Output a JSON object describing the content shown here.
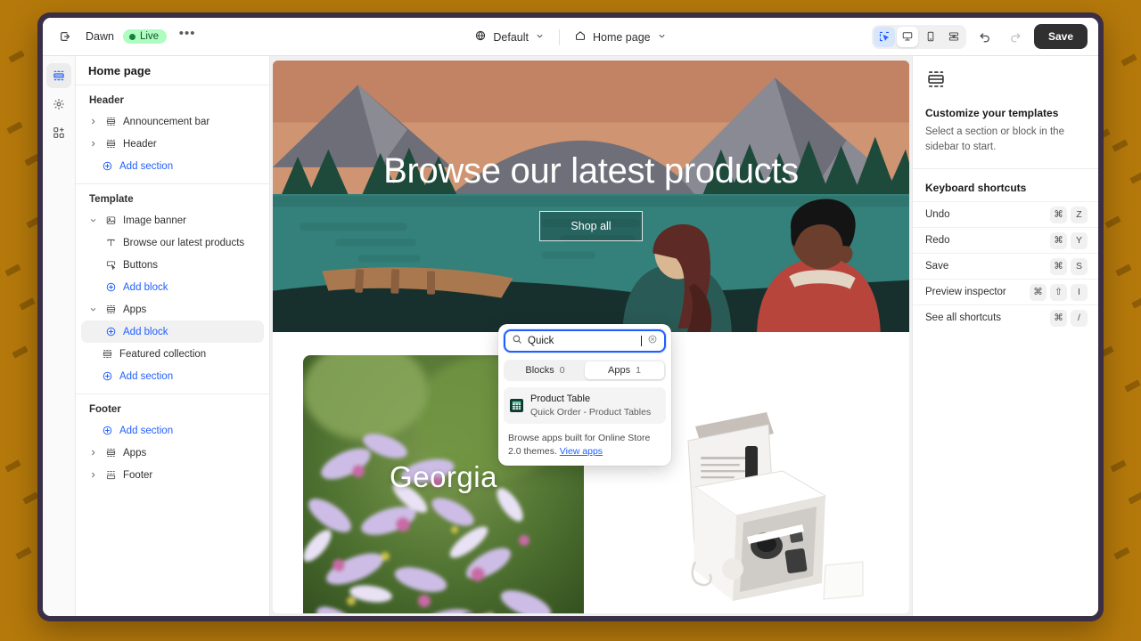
{
  "topbar": {
    "back_icon": "exit-icon",
    "theme_name": "Dawn",
    "live_label": "Live",
    "more_label": "•••",
    "locale_label": "Default",
    "page_label": "Home page",
    "devices": [
      {
        "name": "inspector",
        "active": true
      },
      {
        "name": "desktop",
        "active": true
      },
      {
        "name": "mobile",
        "active": false
      },
      {
        "name": "fullwidth",
        "active": false
      }
    ],
    "undo_label": "Undo",
    "redo_label": "Redo",
    "save_label": "Save"
  },
  "rail": {
    "items": [
      {
        "name": "sections",
        "active": true
      },
      {
        "name": "settings",
        "active": false
      },
      {
        "name": "apps",
        "active": false
      }
    ]
  },
  "sidebar": {
    "title": "Home page",
    "groups": [
      {
        "label": "Header",
        "rows": [
          {
            "label": "Announcement bar",
            "icon": "section-icon",
            "chevron": "right",
            "type": "item"
          },
          {
            "label": "Header",
            "icon": "section-icon",
            "chevron": "right",
            "type": "item"
          },
          {
            "label": "Add section",
            "icon": "plus-circle-icon",
            "type": "action"
          }
        ]
      },
      {
        "label": "Template",
        "rows": [
          {
            "label": "Image banner",
            "icon": "image-icon",
            "chevron": "down",
            "type": "item"
          },
          {
            "label": "Browse our latest products",
            "icon": "text-icon",
            "type": "child"
          },
          {
            "label": "Buttons",
            "icon": "button-icon",
            "type": "child"
          },
          {
            "label": "Add block",
            "icon": "plus-circle-icon",
            "type": "action-child"
          },
          {
            "label": "Apps",
            "icon": "blocks-icon",
            "chevron": "down",
            "type": "item"
          },
          {
            "label": "Add block",
            "icon": "plus-circle-icon",
            "type": "action-child",
            "selected": true
          },
          {
            "label": "Featured collection",
            "icon": "blocks-icon",
            "type": "item-noch"
          },
          {
            "label": "Add section",
            "icon": "plus-circle-icon",
            "type": "action"
          }
        ]
      },
      {
        "label": "Footer",
        "rows": [
          {
            "label": "Add section",
            "icon": "plus-circle-icon",
            "type": "action"
          },
          {
            "label": "Apps",
            "icon": "blocks-icon",
            "chevron": "right",
            "type": "item"
          },
          {
            "label": "Footer",
            "icon": "footer-icon",
            "chevron": "right",
            "type": "item"
          }
        ]
      }
    ]
  },
  "preview": {
    "hero_title": "Browse our latest products",
    "hero_button": "Shop all",
    "flowers_label": "Georgia"
  },
  "popover": {
    "search_value": "Quick",
    "search_placeholder": "Search",
    "clear_label": "Clear",
    "tabs": [
      {
        "label": "Blocks",
        "count": "0",
        "active": false
      },
      {
        "label": "Apps",
        "count": "1",
        "active": true
      }
    ],
    "results": [
      {
        "title": "Product Table",
        "subtitle": "Quick Order - Product Tables"
      }
    ],
    "footer_text": "Browse apps built for Online Store 2.0 themes.",
    "footer_link": "View apps"
  },
  "rightpanel": {
    "icon": "section-icon",
    "title": "Customize your templates",
    "subtitle": "Select a section or block in the sidebar to start.",
    "shortcuts_title": "Keyboard shortcuts",
    "shortcuts": [
      {
        "label": "Undo",
        "keys": [
          "⌘",
          "Z"
        ]
      },
      {
        "label": "Redo",
        "keys": [
          "⌘",
          "Y"
        ]
      },
      {
        "label": "Save",
        "keys": [
          "⌘",
          "S"
        ]
      },
      {
        "label": "Preview inspector",
        "keys": [
          "⌘",
          "⇧",
          "I"
        ]
      },
      {
        "label": "See all shortcuts",
        "keys": [
          "⌘",
          "/"
        ]
      }
    ]
  },
  "colors": {
    "background": "#b5790b",
    "window_border": "#3b2f46",
    "accent": "#1f5eff",
    "live_badge": "#affcc0",
    "save_button": "#303030"
  }
}
